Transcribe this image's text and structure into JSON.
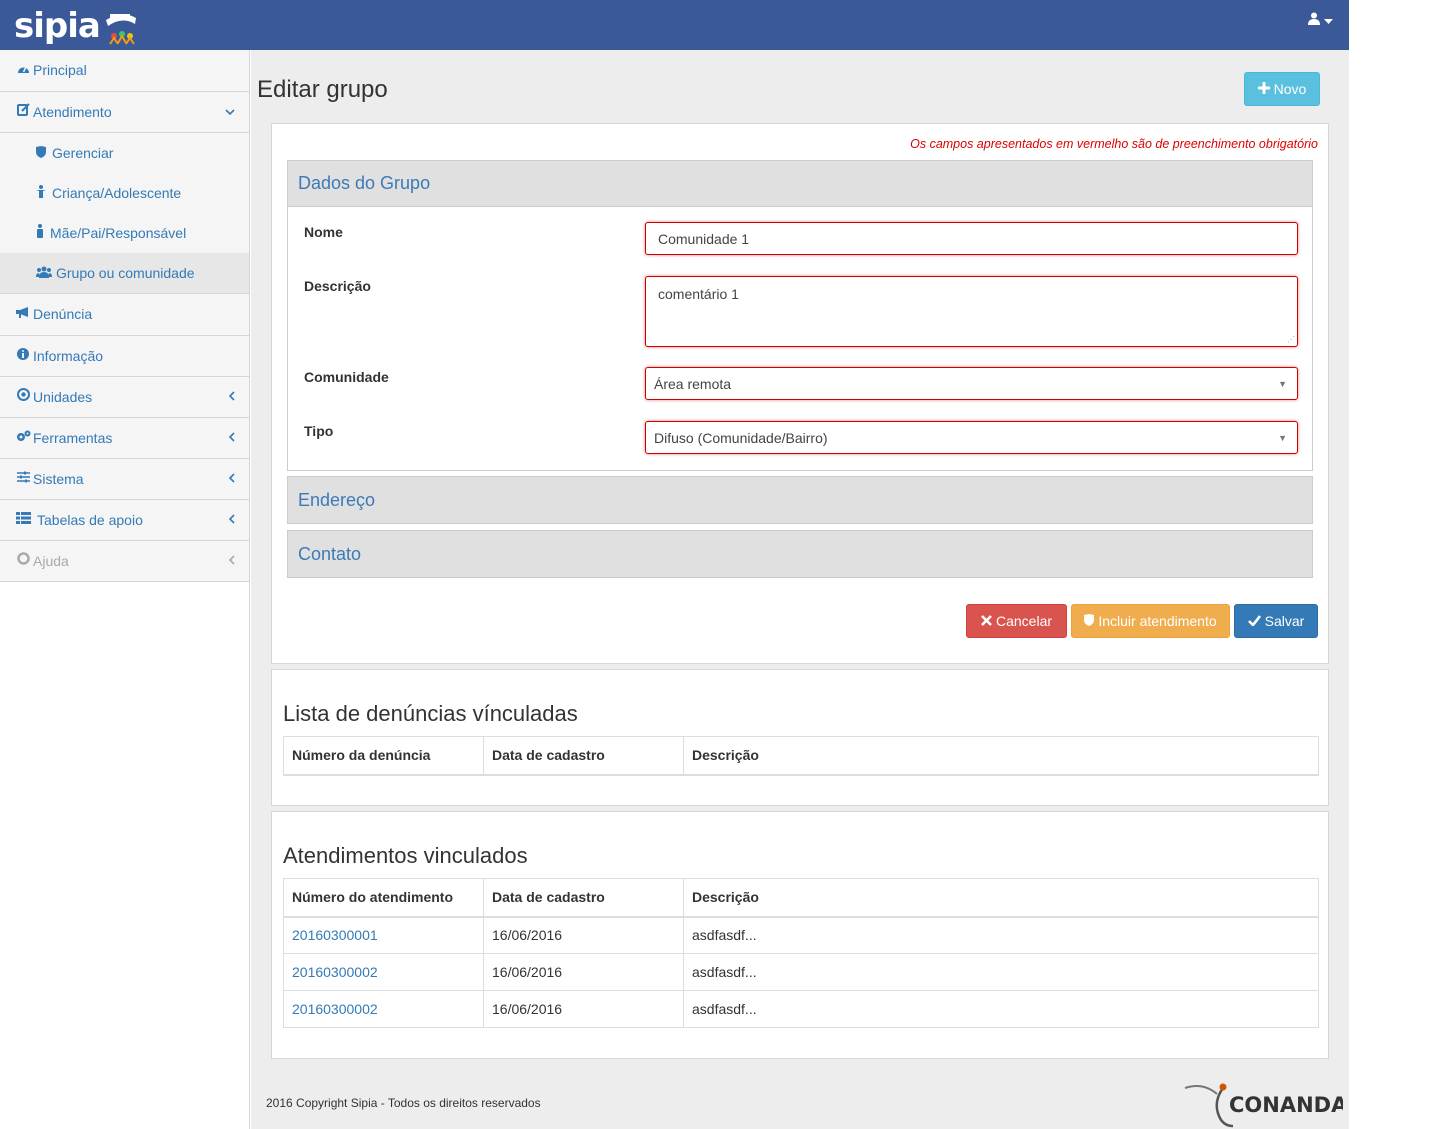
{
  "brand": {
    "name": "sipia"
  },
  "header": {
    "user_icon": "user-icon"
  },
  "sidebar": {
    "items": [
      {
        "label": "Principal",
        "icon": "dashboard-icon"
      },
      {
        "label": "Atendimento",
        "icon": "edit-icon"
      },
      {
        "label": "Denúncia",
        "icon": "bullhorn-icon"
      },
      {
        "label": "Informação",
        "icon": "info-icon"
      },
      {
        "label": "Unidades",
        "icon": "circle-dot-icon"
      },
      {
        "label": "Ferramentas",
        "icon": "gears-icon"
      },
      {
        "label": "Sistema",
        "icon": "sliders-icon"
      },
      {
        "label": "Tabelas de apoio",
        "icon": "table-icon"
      },
      {
        "label": "Ajuda",
        "icon": "lifebuoy-icon"
      }
    ],
    "subitems": [
      {
        "label": "Gerenciar",
        "icon": "shield-icon"
      },
      {
        "label": "Criança/Adolescente",
        "icon": "child-icon"
      },
      {
        "label": "Mãe/Pai/Responsável",
        "icon": "person-icon"
      },
      {
        "label": "Grupo ou comunidade",
        "icon": "users-icon"
      }
    ]
  },
  "page": {
    "title": "Editar grupo",
    "novo_label": "Novo",
    "required_note": "Os campos apresentados em vermelho são de preenchimento obrigatório"
  },
  "form": {
    "section_dados": "Dados do Grupo",
    "section_endereco": "Endereço",
    "section_contato": "Contato",
    "nome_label": "Nome",
    "nome_value": "Comunidade 1",
    "descricao_label": "Descrição",
    "descricao_value": "comentário 1",
    "comunidade_label": "Comunidade",
    "comunidade_value": "Área remota",
    "tipo_label": "Tipo",
    "tipo_value": "Difuso (Comunidade/Bairro)",
    "cancel_label": "Cancelar",
    "incluir_label": "Incluir atendimento",
    "salvar_label": "Salvar"
  },
  "denuncias": {
    "title": "Lista de denúncias vínculadas",
    "headers": [
      "Número da denúncia",
      "Data de cadastro",
      "Descrição"
    ]
  },
  "atendimentos": {
    "title": "Atendimentos vinculados",
    "headers": [
      "Número do atendimento",
      "Data de cadastro",
      "Descrição"
    ],
    "rows": [
      {
        "numero": "20160300001",
        "data": "16/06/2016",
        "descricao": "asdfasdf..."
      },
      {
        "numero": "20160300002",
        "data": "16/06/2016",
        "descricao": "asdfasdf..."
      },
      {
        "numero": "20160300002",
        "data": "16/06/2016",
        "descricao": "asdfasdf..."
      }
    ]
  },
  "footer": {
    "text": "2016 Copyright Sipia - Todos os direitos reservados",
    "partner_logo": "CONANDA"
  }
}
